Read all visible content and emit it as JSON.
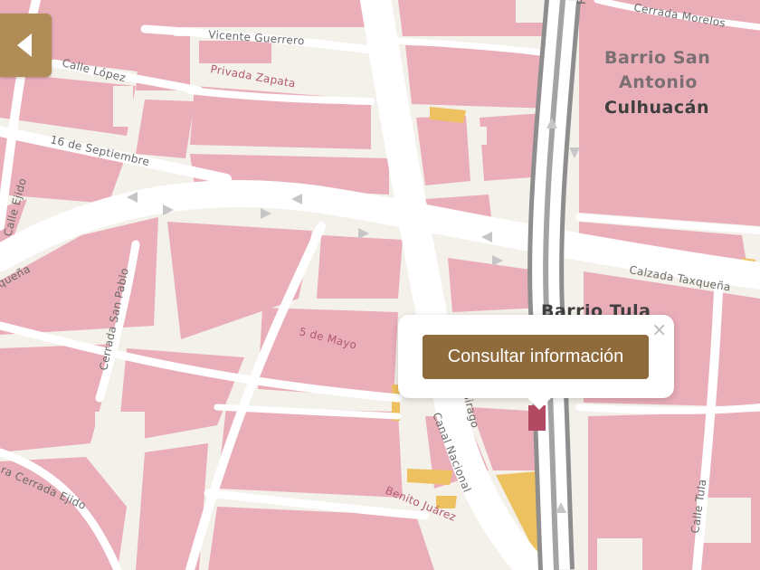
{
  "colors": {
    "block": "#eaaeb9",
    "street": "#ffffff",
    "background": "#f4f1ea",
    "highway": "#9a9a9a",
    "highlight": "#edc060",
    "marker": "#b24a63",
    "accent": "#8f6a3b",
    "back_button": "#b08d57"
  },
  "streets": {
    "cerrada_morelos": "Cerrada Morelos",
    "vicente_guerrero": "Vicente Guerrero",
    "calle_lopez": "Calle López",
    "privada_zapata": "Privada Zapata",
    "dieciseis_septiembre": "16 de Septiembre",
    "calle_ejido": "Calle Ejido",
    "quena": "queña",
    "cerrada_san_pablo": "Cerrada San Pablo",
    "calzada_taxquena": "Calzada Taxqueña",
    "cinco_mayo": "5 de Mayo",
    "sirago": "Sirago",
    "canal_nacional": "Canal Nacional",
    "cerrada_ejido": "ra Cerrada Ejido",
    "benito_juarez": "Benito Juárez",
    "calle_tula": "Calle Tula",
    "highway_fragment": "R"
  },
  "districts": {
    "san_antonio_line1": "Barrio San",
    "san_antonio_line2": "Antonio",
    "san_antonio_line3": "Culhuacán",
    "tula": "Barrio Tula"
  },
  "popup": {
    "button_label": "Consultar información",
    "close_symbol": "×"
  },
  "icons": {
    "back": "chevron-left-icon",
    "close": "close-icon",
    "marker": "location-marker-icon"
  }
}
